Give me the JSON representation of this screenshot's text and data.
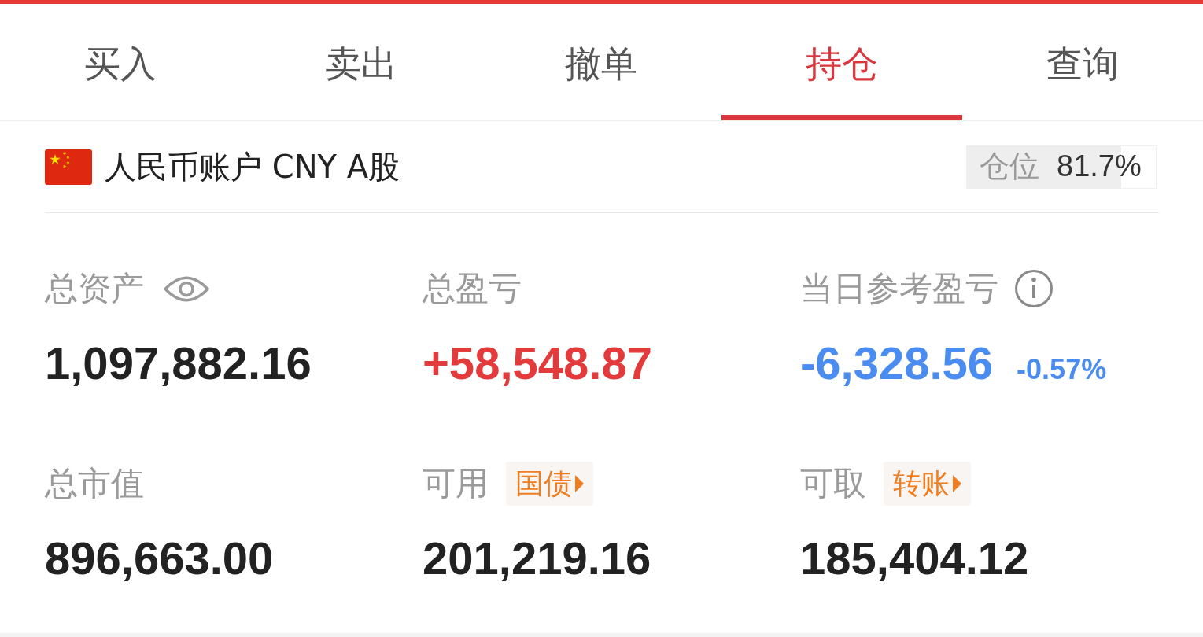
{
  "tabs": [
    {
      "label": "买入",
      "selected": false
    },
    {
      "label": "卖出",
      "selected": false
    },
    {
      "label": "撤单",
      "selected": false
    },
    {
      "label": "持仓",
      "selected": true
    },
    {
      "label": "查询",
      "selected": false
    }
  ],
  "account": {
    "name": "人民币账户 CNY A股",
    "position": {
      "label": "仓位",
      "value": "81.7%",
      "level": 0.817
    }
  },
  "stats": [
    {
      "kind": "hidable",
      "label": "总资产",
      "value": "1,097,882.16",
      "color": "#222222"
    },
    {
      "kind": "plain",
      "label": "总盈亏",
      "value": "+58,548.87",
      "color": "#e33b3b"
    },
    {
      "kind": "info",
      "label": "当日参考盈亏",
      "value": "-6,328.56",
      "change": "-0.57%",
      "color": "#4a8cf0"
    },
    {
      "kind": "plain",
      "label": "总市值",
      "value": "896,663.00",
      "color": "#222222"
    },
    {
      "kind": "action",
      "label": "可用",
      "action": "国债",
      "value": "201,219.16",
      "color": "#222222"
    },
    {
      "kind": "action",
      "label": "可取",
      "action": "转账",
      "value": "185,404.12",
      "color": "#222222"
    }
  ]
}
